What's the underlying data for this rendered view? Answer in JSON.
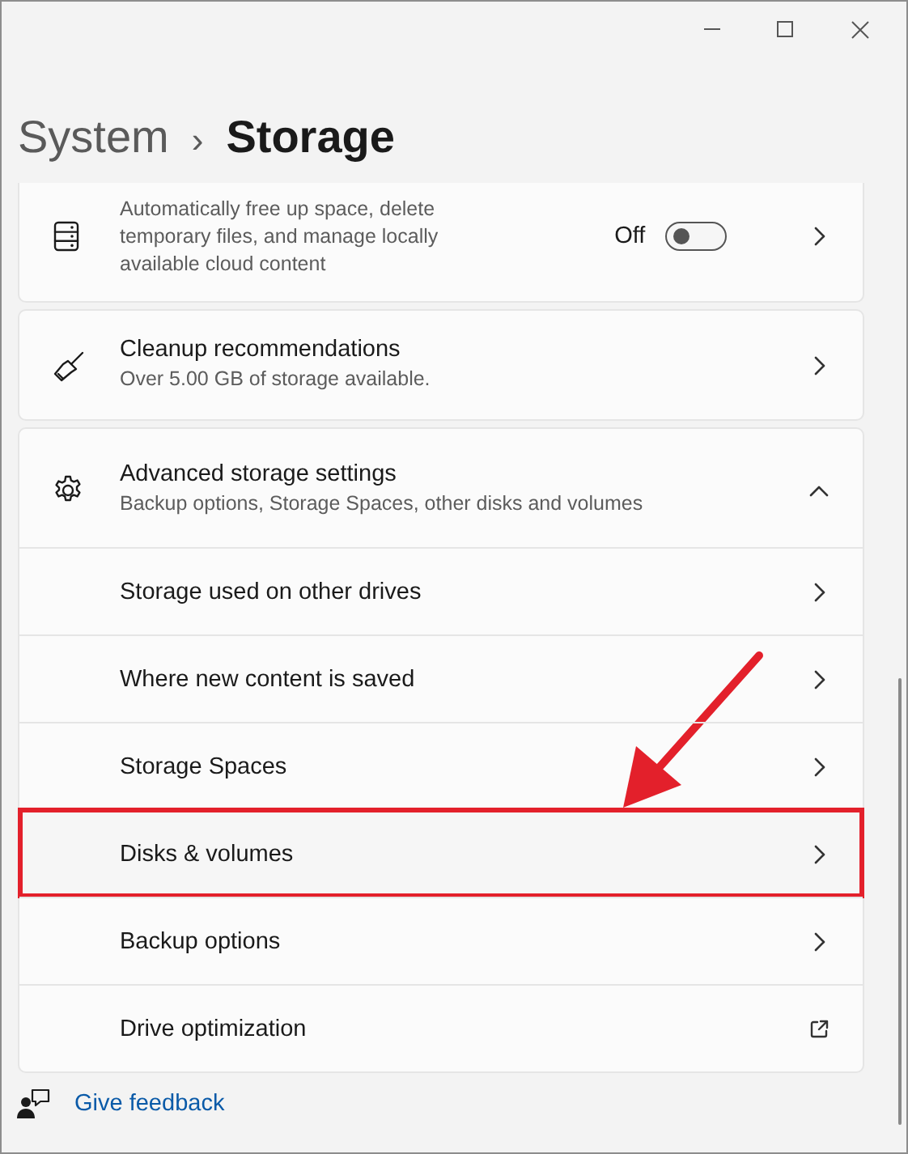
{
  "breadcrumb": {
    "parent": "System",
    "separator": "›",
    "current": "Storage"
  },
  "cards": [
    {
      "kind": "toggle",
      "description": "Automatically free up space, delete temporary files, and manage locally available cloud content",
      "toggle_label": "Off",
      "on": false
    },
    {
      "kind": "link",
      "title": "Cleanup recommendations",
      "description": "Over 5.00 GB of storage available."
    },
    {
      "kind": "expander",
      "title": "Advanced storage settings",
      "description": "Backup options, Storage Spaces, other disks and volumes",
      "expanded": true,
      "children": [
        {
          "kind": "link",
          "label": "Storage used on other drives",
          "highlighted": false
        },
        {
          "kind": "link",
          "label": "Where new content is saved",
          "highlighted": false
        },
        {
          "kind": "link",
          "label": "Storage Spaces",
          "highlighted": false
        },
        {
          "kind": "link",
          "label": "Disks & volumes",
          "highlighted": true
        },
        {
          "kind": "link",
          "label": "Backup options",
          "highlighted": false
        },
        {
          "kind": "external",
          "label": "Drive optimization",
          "highlighted": false
        }
      ]
    }
  ],
  "feedback": {
    "label": "Give feedback"
  }
}
